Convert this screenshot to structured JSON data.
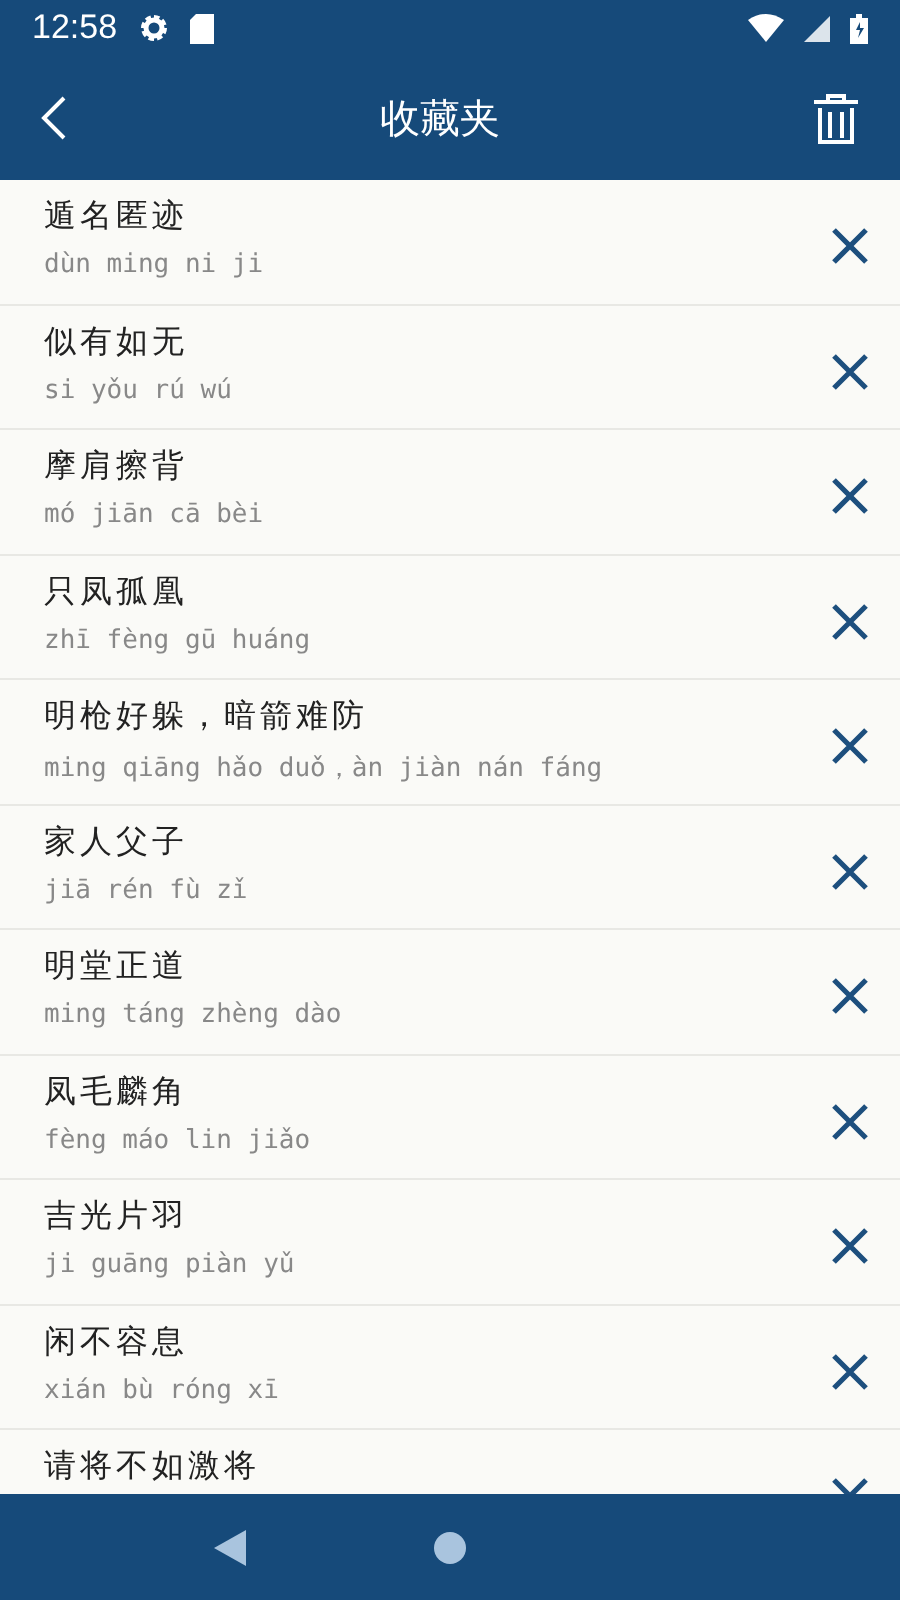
{
  "status_bar": {
    "time": "12:58"
  },
  "toolbar": {
    "title": "收藏夹"
  },
  "items": [
    {
      "idiom": "遁名匿迹",
      "pinyin": "dùn ming ni ji"
    },
    {
      "idiom": "似有如无",
      "pinyin": "si yǒu rú wú"
    },
    {
      "idiom": "摩肩擦背",
      "pinyin": "mó jiān cā bèi"
    },
    {
      "idiom": "只凤孤凰",
      "pinyin": "zhī fèng gū huáng"
    },
    {
      "idiom": "明枪好躲，暗箭难防",
      "pinyin": "ming qiāng hǎo duǒ，àn jiàn nán fáng"
    },
    {
      "idiom": "家人父子",
      "pinyin": "jiā rén fù zǐ"
    },
    {
      "idiom": "明堂正道",
      "pinyin": "ming táng zhèng dào"
    },
    {
      "idiom": "凤毛麟角",
      "pinyin": "fèng máo lin jiǎo"
    },
    {
      "idiom": "吉光片羽",
      "pinyin": "ji guāng piàn yǔ"
    },
    {
      "idiom": "闲不容息",
      "pinyin": "xián bù róng xī"
    },
    {
      "idiom": "请将不如激将"
    }
  ]
}
